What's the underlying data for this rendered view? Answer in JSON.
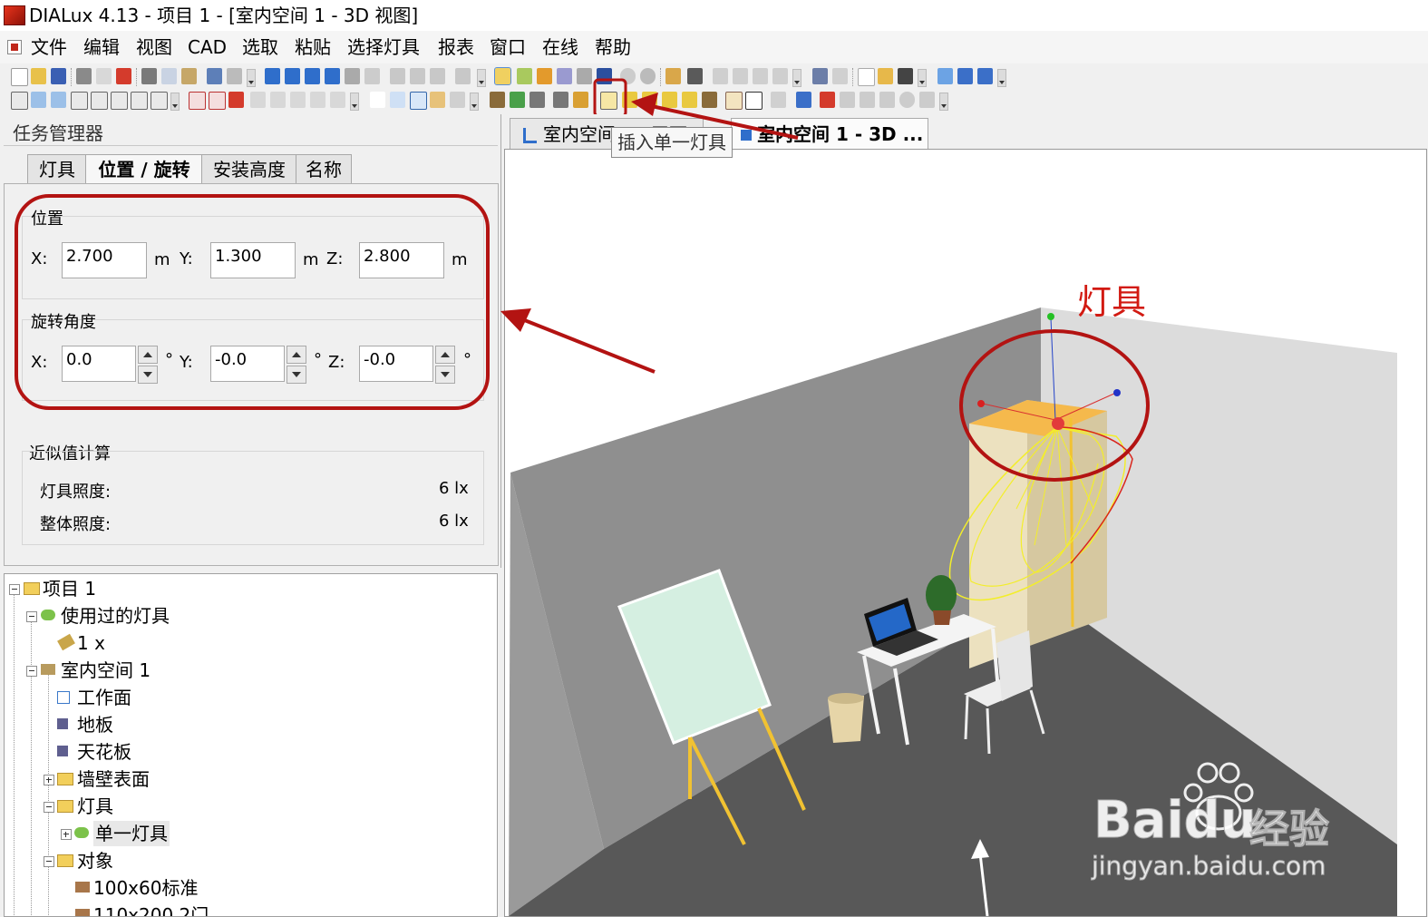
{
  "window": {
    "title": "DIALux 4.13 - 项目 1 - [室内空间 1 - 3D 视图]"
  },
  "menu": [
    "文件",
    "编辑",
    "视图",
    "CAD",
    "选取",
    "粘贴",
    "选择灯具",
    "报表",
    "窗口",
    "在线",
    "帮助"
  ],
  "tooltip": "插入单一灯具",
  "task_manager": {
    "title": "任务管理器",
    "tabs": [
      "灯具",
      "位置 / 旋转",
      "安装高度",
      "名称"
    ],
    "position": {
      "label": "位置",
      "x_label": "X:",
      "x": "2.700",
      "y_label": "Y:",
      "y": "1.300",
      "z_label": "Z:",
      "z": "2.800",
      "unit": "m"
    },
    "rotation": {
      "label": "旋转角度",
      "x_label": "X:",
      "x": "0.0",
      "y_label": "Y:",
      "y": "-0.0",
      "z_label": "Z:",
      "z": "-0.0",
      "unit": "°"
    },
    "approx": {
      "label": "近似值计算",
      "luminaire_label": "灯具照度:",
      "luminaire_value": "6 lx",
      "overall_label": "整体照度:",
      "overall_value": "6 lx"
    }
  },
  "tree": {
    "project": "项目 1",
    "used_lamps": "使用过的灯具",
    "lamp_count": "1 x",
    "room": "室内空间 1",
    "workplane": "工作面",
    "floor": "地板",
    "ceiling": "天花板",
    "walls": "墙壁表面",
    "lamps": "灯具",
    "single_lamp": "单一灯具",
    "objects": "对象",
    "obj1": "100x60标准",
    "obj2": "110x200 2门"
  },
  "doc_tabs": {
    "plan": "室内空间 1 - 平面",
    "view3d": "室内空间 1 - 3D ..."
  },
  "annotation": {
    "lamp": "灯具"
  },
  "watermark": {
    "brand": "Baidu",
    "brand_cn": "经验",
    "url": "jingyan.baidu.com"
  },
  "colors": {
    "annotation_red": "#b31312",
    "accent_blue": "#1f6fd0"
  }
}
